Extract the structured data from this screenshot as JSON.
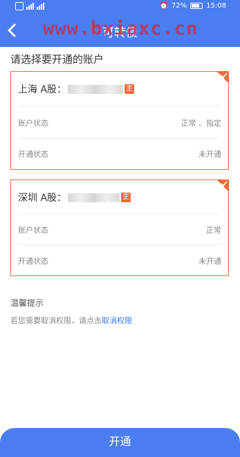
{
  "status_bar": {
    "battery": "72%",
    "time": "15:08"
  },
  "header": {
    "title": "可转债",
    "watermark": "www.bxiaxc.cn"
  },
  "section_title": "请选择要开通的账户",
  "accounts": [
    {
      "market_label": "上海 A股：",
      "tag": "主",
      "status_label": "账户状态",
      "status_value": "正常 、指定",
      "open_label": "开通状态",
      "open_value": "未开通"
    },
    {
      "market_label": "深圳 A股：",
      "tag": "主",
      "status_label": "账户状态",
      "status_value": "正常",
      "open_label": "开通状态",
      "open_value": "未开通"
    }
  ],
  "tips": {
    "title": "温馨提示",
    "text": "若您需要取消权限，请点击",
    "link": "取消权限"
  },
  "open_button": "开通",
  "colors": {
    "primary": "#4a7ef0",
    "accent": "#ec6b3c",
    "link": "#3a7ce8"
  }
}
